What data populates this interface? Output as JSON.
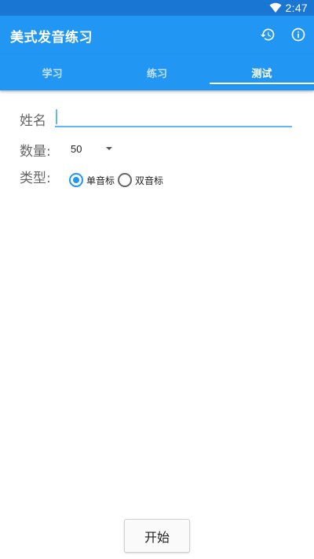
{
  "status_bar": {
    "time": "2:47",
    "wifi_icon": "wifi-icon"
  },
  "app_bar": {
    "title": "美式发音练习",
    "actions": [
      {
        "icon": "history-icon"
      },
      {
        "icon": "info-icon"
      }
    ]
  },
  "tabs": [
    {
      "label": "学习",
      "active": false
    },
    {
      "label": "练习",
      "active": false
    },
    {
      "label": "测试",
      "active": true
    }
  ],
  "form": {
    "name_label": "姓名",
    "name_value": "",
    "quantity_label": "数量:",
    "quantity_value": "50",
    "type_label": "类型:",
    "type_options": [
      {
        "label": "单音标",
        "checked": true
      },
      {
        "label": "双音标",
        "checked": false
      }
    ]
  },
  "start_button": {
    "label": "开始"
  },
  "colors": {
    "primary": "#2196f3",
    "primary_dark": "#1976d2",
    "accent_line": "#64b5f6"
  }
}
